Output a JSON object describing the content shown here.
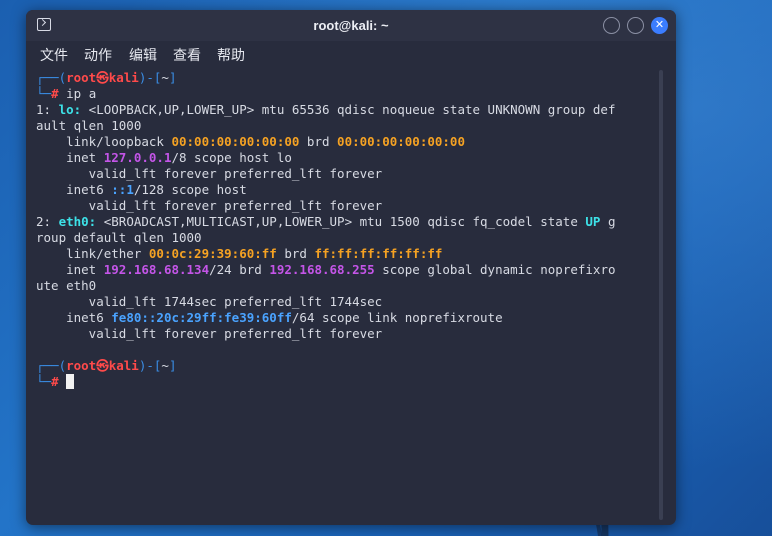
{
  "window": {
    "title": "root@kali: ~",
    "buttons": {
      "minimize": "",
      "maximize": "",
      "close": "✕"
    }
  },
  "menu": {
    "file": "文件",
    "action": "动作",
    "edit": "编辑",
    "view": "查看",
    "help": "帮助"
  },
  "prompt": {
    "bracket_open": "┌──(",
    "user": "root㉿kali",
    "mid": ")-[",
    "dir": "~",
    "bracket_close": "]",
    "second_prefix": "└─",
    "hash": "#"
  },
  "command": "ip a",
  "output": {
    "l1_num": "1: ",
    "l1_if": "lo:",
    "l1_rest": " <LOOPBACK,UP,LOWER_UP> mtu 65536 qdisc noqueue state UNKNOWN group def",
    "l2": "ault qlen 1000",
    "l3_a": "    link/loopback ",
    "l3_mac": "00:00:00:00:00:00",
    "l3_b": " brd ",
    "l3_brd": "00:00:00:00:00:00",
    "l4_a": "    inet ",
    "l4_ip": "127.0.0.1",
    "l4_b": "/8 scope host lo",
    "l5": "       valid_lft forever preferred_lft forever",
    "l6_a": "    inet6 ",
    "l6_ip": "::1",
    "l6_b": "/128 scope host",
    "l7": "       valid_lft forever preferred_lft forever",
    "l8_num": "2: ",
    "l8_if": "eth0:",
    "l8_rest": " <BROADCAST,MULTICAST,UP,LOWER_UP> mtu 1500 qdisc fq_codel state ",
    "l8_up": "UP",
    "l8_tail": " g",
    "l9": "roup default qlen 1000",
    "l10_a": "    link/ether ",
    "l10_mac": "00:0c:29:39:60:ff",
    "l10_b": " brd ",
    "l10_brd": "ff:ff:ff:ff:ff:ff",
    "l11_a": "    inet ",
    "l11_ip": "192.168.68.134",
    "l11_b": "/24 brd ",
    "l11_brd": "192.168.68.255",
    "l11_c": " scope global dynamic noprefixro",
    "l12": "ute eth0",
    "l13": "       valid_lft 1744sec preferred_lft 1744sec",
    "l14_a": "    inet6 ",
    "l14_ip": "fe80::20c:29ff:fe39:60ff",
    "l14_b": "/64 scope link noprefixroute",
    "l15": "       valid_lft forever preferred_lft forever"
  },
  "colors": {
    "desktop": "#1f6bbd",
    "terminal_bg": "#282c3d",
    "prompt_blue": "#3a8ee6",
    "prompt_red": "#ff4a4a",
    "mac_orange": "#f5a223",
    "ip_purple": "#c455e8",
    "ipv6_blue": "#4aa3ff",
    "state_cyan": "#3de2e8"
  },
  "icons": [
    "terminal-icon",
    "minimize-icon",
    "maximize-icon",
    "close-icon",
    "kali-dragon-logo"
  ]
}
